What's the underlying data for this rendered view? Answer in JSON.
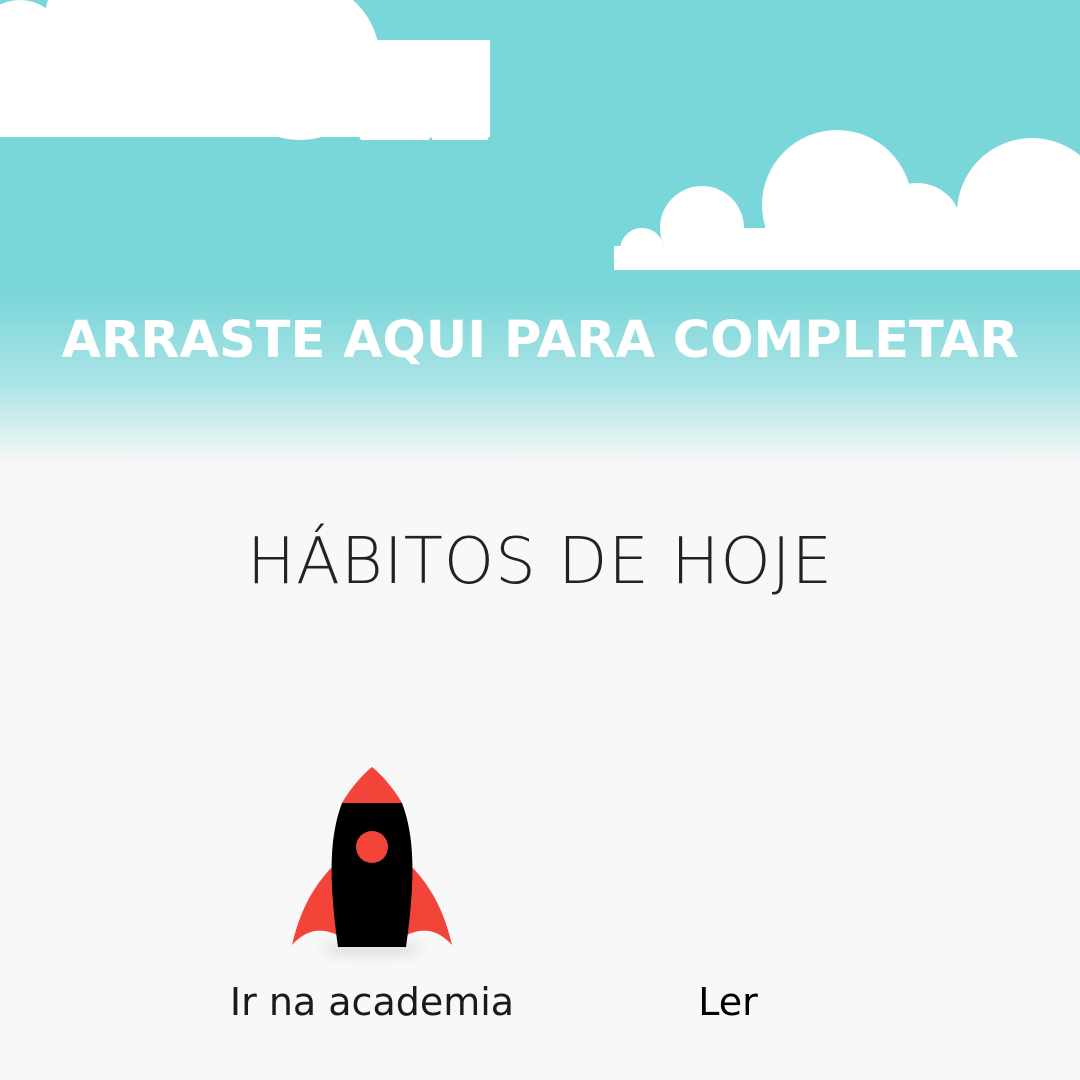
{
  "drop_zone": {
    "label": "ARRASTE AQUI PARA COMPLETAR"
  },
  "page_title": "HÁBITOS DE HOJE",
  "habits": [
    {
      "label": "Ir na academia",
      "icon": "rocket-icon"
    },
    {
      "label": "Ler",
      "icon": ""
    }
  ],
  "colors": {
    "sky": "#79d6d9",
    "background": "#f8f8f8",
    "cloud": "#ffffff",
    "rocket_body": "#000000",
    "rocket_accent": "#f24438"
  }
}
